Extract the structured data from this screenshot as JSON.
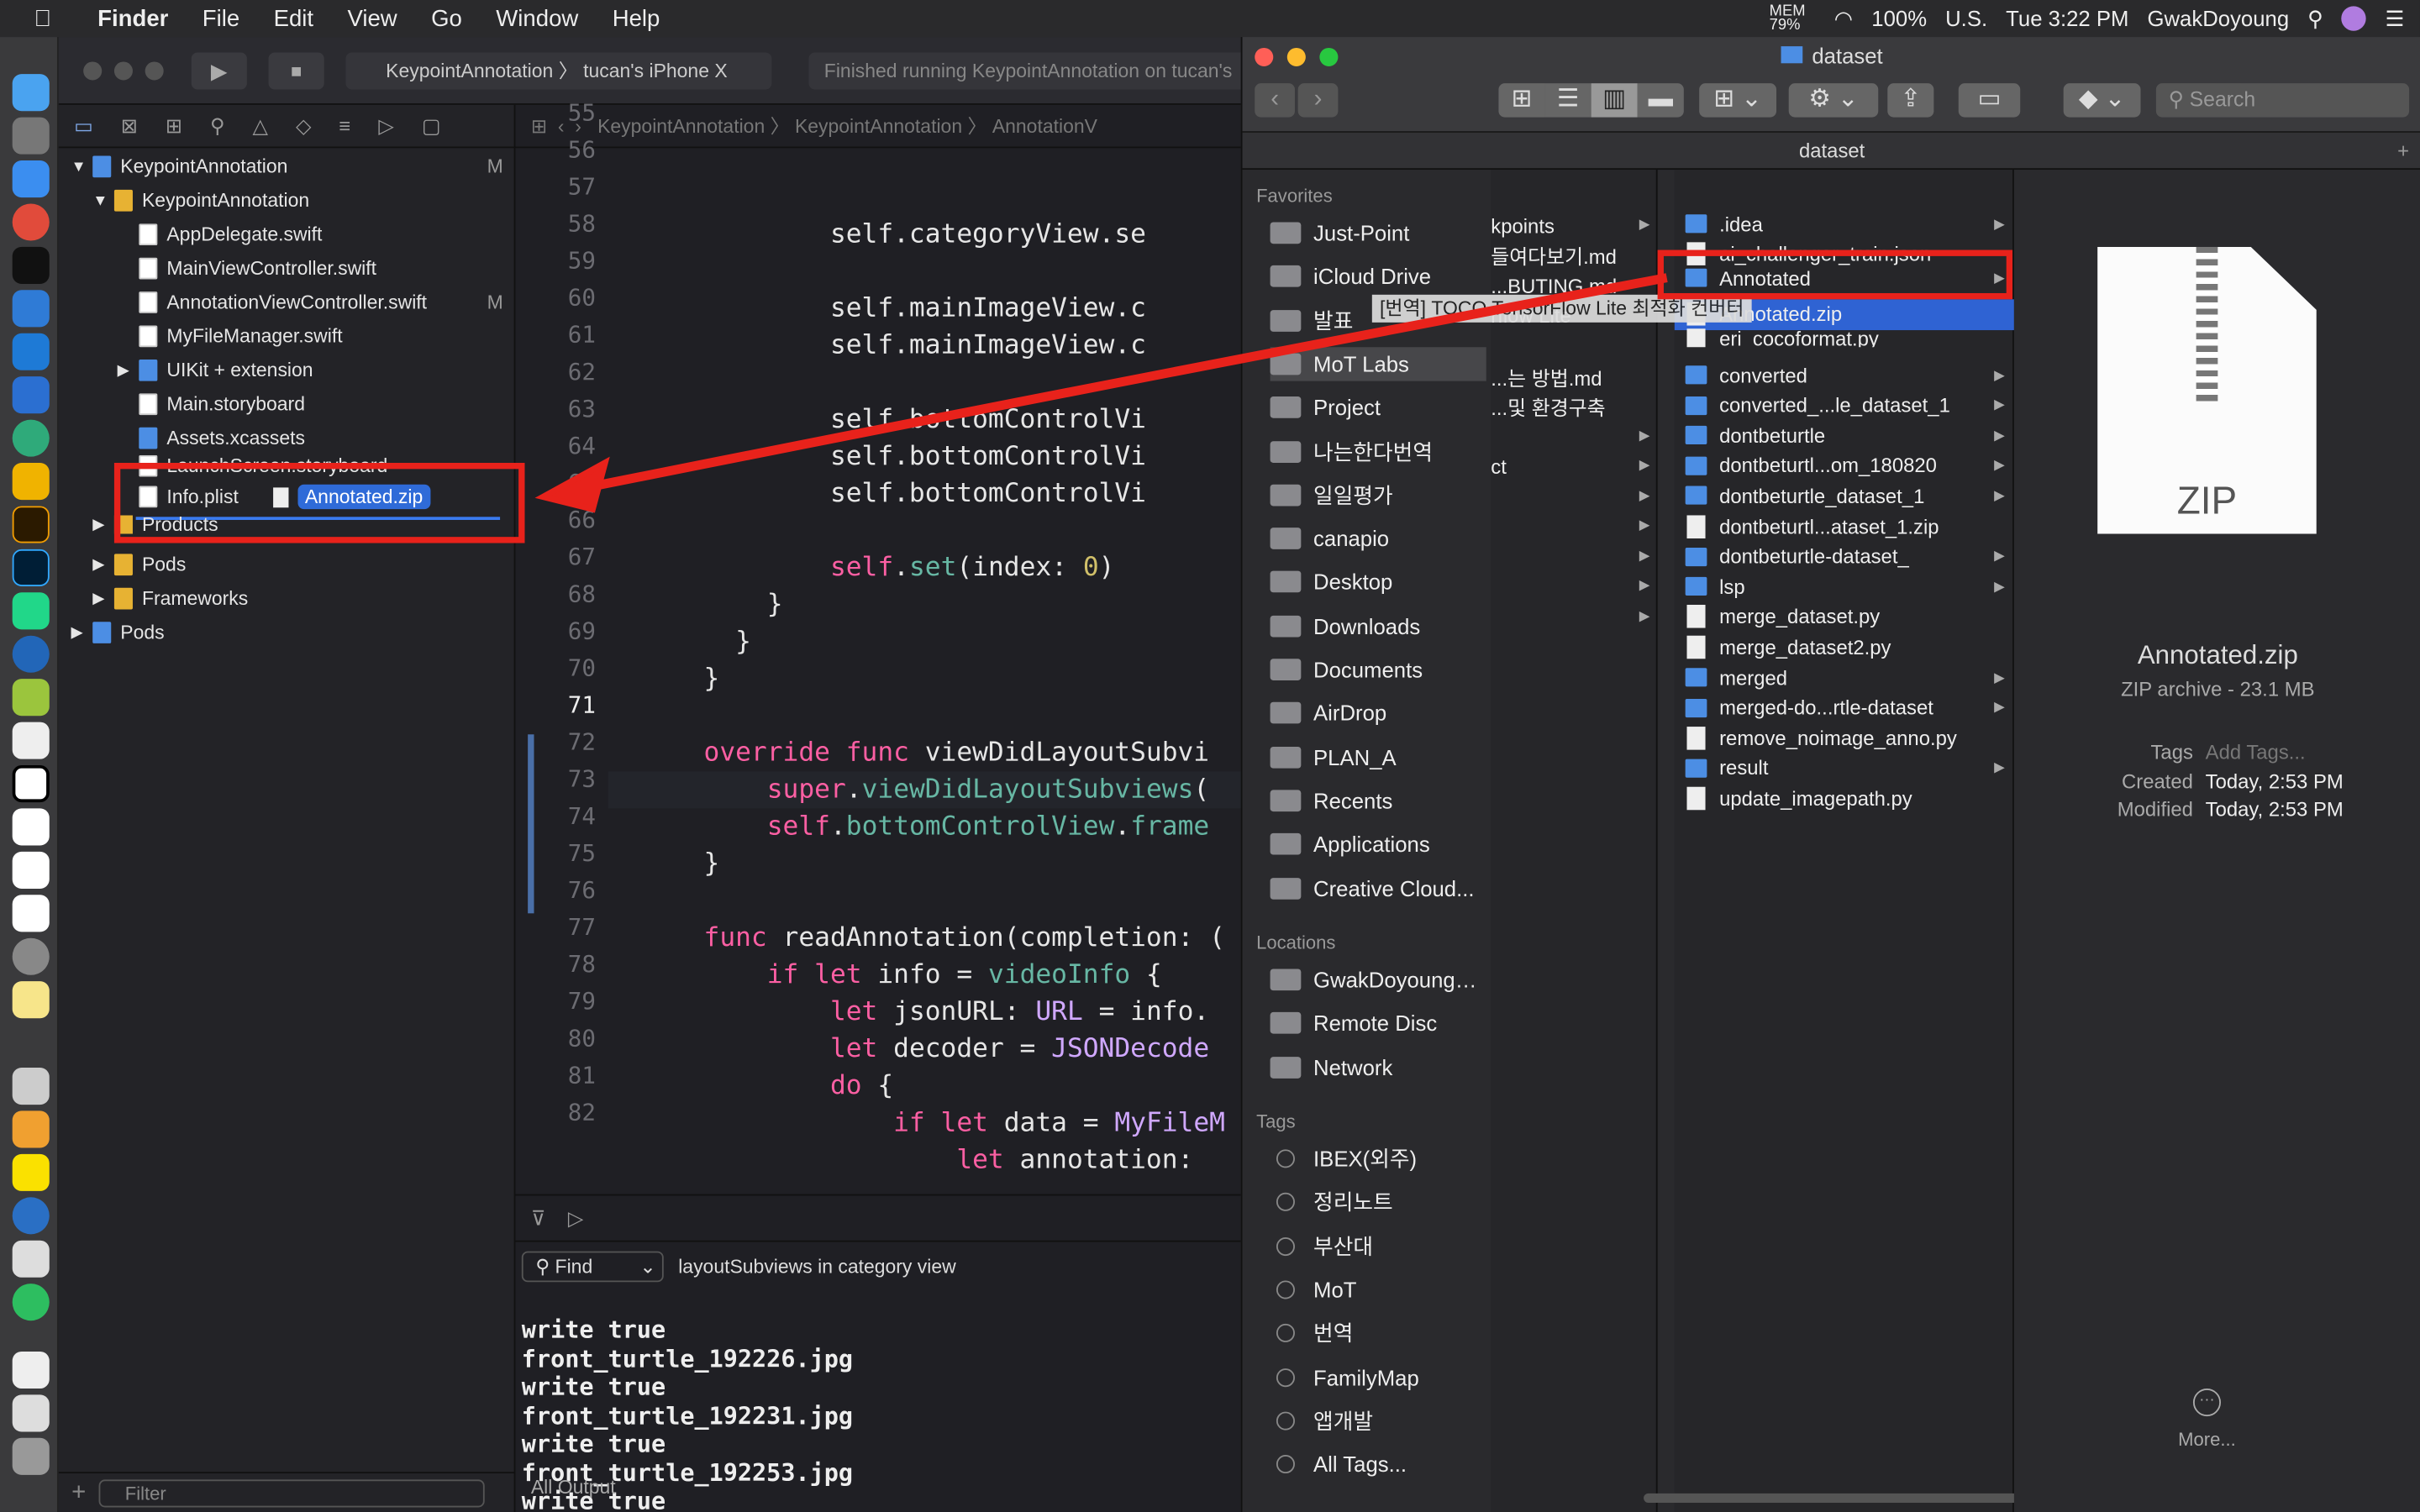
{
  "menubar": {
    "items": [
      "File",
      "Edit",
      "View",
      "Go",
      "Window",
      "Help"
    ],
    "app": "Finder",
    "mem": "MEM 79%",
    "battery": "100%",
    "lang": "U.S.",
    "clock": "Tue 3:22 PM",
    "user": "GwakDoyoung"
  },
  "xcode": {
    "scheme": "KeypointAnnotation",
    "device": "tucan's iPhone X",
    "status": "Finished running KeypointAnnotation on tucan's",
    "breadcrumb": [
      "KeypointAnnotation",
      "KeypointAnnotation",
      "AnnotationV"
    ],
    "nav": [
      {
        "label": "KeypointAnnotation",
        "badge": "M"
      },
      {
        "label": "KeypointAnnotation"
      },
      {
        "label": "AppDelegate.swift"
      },
      {
        "label": "MainViewController.swift"
      },
      {
        "label": "AnnotationViewController.swift",
        "badge": "M"
      },
      {
        "label": "MyFileManager.swift"
      },
      {
        "label": "UIKit + extension"
      },
      {
        "label": "Main.storyboard"
      },
      {
        "label": "Assets.xcassets"
      },
      {
        "label": "LaunchScreen.storyboard"
      },
      {
        "label": "Info.plist"
      },
      {
        "label": "Products"
      },
      {
        "label": "Pods"
      },
      {
        "label": "Frameworks"
      },
      {
        "label": "Pods"
      }
    ],
    "drag_label": "Annotated.zip",
    "filter": "Filter",
    "line_numbers": [
      "55",
      "56",
      "57",
      "58",
      "59",
      "60",
      "61",
      "62",
      "63",
      "64",
      "65",
      "66",
      "67",
      "68",
      "69",
      "70",
      "71",
      "72",
      "73",
      "74",
      "75",
      "76",
      "77",
      "78",
      "79",
      "80",
      "81",
      "82"
    ],
    "find_label": "Find",
    "find_query": "layoutSubviews in category view",
    "console": [
      "write true",
      "front_turtle_192226.jpg",
      "write true",
      "front_turtle_192231.jpg",
      "write true",
      "front_turtle_192253.jpg",
      "write true"
    ],
    "output_label": "All Output"
  },
  "finder": {
    "title": "dataset",
    "path": "dataset",
    "search": "Search",
    "favorites_header": "Favorites",
    "favorites": [
      "Just-Point",
      "iCloud Drive",
      "발표",
      "MoT Labs",
      "Project",
      "나는한다번역",
      "일일평가",
      "canapio",
      "Desktop",
      "Downloads",
      "Documents",
      "AirDrop",
      "PLAN_A",
      "Recents",
      "Applications",
      "Creative Cloud..."
    ],
    "locations_header": "Locations",
    "locations": [
      "GwakDoyoung…",
      "Remote Disc",
      "Network"
    ],
    "tags_header": "Tags",
    "tags": [
      "IBEX(외주)",
      "정리노트",
      "부산대",
      "MoT",
      "번역",
      "FamilyMap",
      "앱개발",
      "All Tags..."
    ],
    "col1": [
      "kpoints",
      "들여다보기.md",
      "...BUTING.md",
      "rflow Lite",
      "...는 방법.md",
      "...및 환경구축",
      "ct"
    ],
    "tooltip": "[번역] TOCO TensorFlow Lite 최적화 컨버터",
    "col2": [
      ".idea",
      "ai_challenger_train.json",
      "Annotated",
      "Annotated.zip",
      "eri_cocoformat.py",
      "converted",
      "converted_...le_dataset_1",
      "dontbeturtle",
      "dontbeturtl...om_180820",
      "dontbeturtle_dataset_1",
      "dontbeturtl...ataset_1.zip",
      "dontbeturtle-dataset_",
      "lsp",
      "merge_dataset.py",
      "merge_dataset2.py",
      "merged",
      "merged-do...rtle-dataset",
      "remove_noimage_anno.py",
      "result",
      "update_imagepath.py"
    ],
    "preview": {
      "icon_text": "ZIP",
      "name": "Annotated.zip",
      "kind": "ZIP archive - 23.1 MB",
      "tags_label": "Tags",
      "tags_value": "Add Tags...",
      "created_label": "Created",
      "created": "Today, 2:53 PM",
      "modified_label": "Modified",
      "modified": "Today, 2:53 PM",
      "more": "More..."
    }
  }
}
